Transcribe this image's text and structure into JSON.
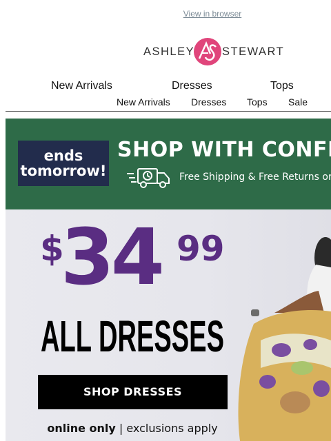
{
  "header": {
    "view_in_browser": "View in browser",
    "brand_left": "ASHLEY",
    "brand_right": "STEWART",
    "brand_monogram": "AS",
    "brand_color": "#e0457b"
  },
  "nav_primary": [
    "New Arrivals",
    "Dresses",
    "Tops"
  ],
  "nav_secondary": [
    "New Arrivals",
    "Dresses",
    "Tops",
    "Sale"
  ],
  "promo_banner": {
    "ends_line1": "ends",
    "ends_line2": "tomorrow!",
    "headline": "SHOP WITH CONFI",
    "subline": "Free Shipping & Free Returns or",
    "truck_icon": "delivery-truck-icon",
    "background_color": "#2e6b48"
  },
  "hero": {
    "price_dollar": "$",
    "price_whole": "34",
    "price_cents": "99",
    "headline": "ALL DRESSES",
    "cta_label": "SHOP DRESSES",
    "fine_print_bold": "online only",
    "fine_print_rest": " | exclusions apply",
    "price_color": "#5a2d82"
  }
}
